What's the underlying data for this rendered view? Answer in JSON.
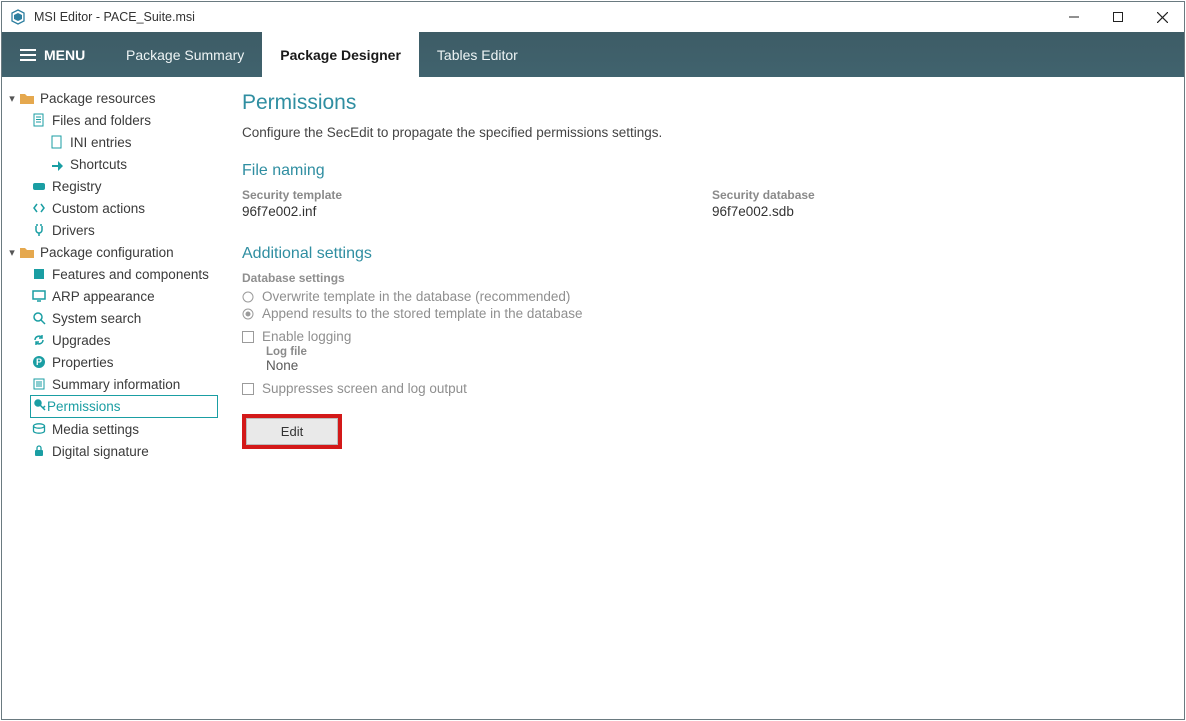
{
  "window": {
    "title": "MSI Editor - PACE_Suite.msi"
  },
  "menu": {
    "label": "MENU"
  },
  "tabs": [
    {
      "label": "Package Summary",
      "active": false
    },
    {
      "label": "Package Designer",
      "active": true
    },
    {
      "label": "Tables Editor",
      "active": false
    }
  ],
  "sidebar": {
    "section1": {
      "label": "Package resources",
      "files_folders": "Files and folders",
      "ini": "INI entries",
      "shortcuts": "Shortcuts",
      "registry": "Registry",
      "custom_actions": "Custom actions",
      "drivers": "Drivers"
    },
    "section2": {
      "label": "Package configuration",
      "features": "Features and components",
      "arp": "ARP appearance",
      "search": "System search",
      "upgrades": "Upgrades",
      "properties": "Properties",
      "summary": "Summary information",
      "permissions": "Permissions",
      "media": "Media settings",
      "signature": "Digital signature"
    }
  },
  "page": {
    "title": "Permissions",
    "desc": "Configure the SecEdit to propagate the specified permissions settings.",
    "file_naming": {
      "heading": "File naming",
      "template_label": "Security template",
      "template_value": "96f7e002.inf",
      "database_label": "Security database",
      "database_value": "96f7e002.sdb"
    },
    "additional": {
      "heading": "Additional settings",
      "db_label": "Database settings",
      "opt_overwrite": "Overwrite template in the database (recommended)",
      "opt_append": "Append results to the stored template in the database",
      "opt_logging": "Enable logging",
      "log_file_label": "Log file",
      "log_file_value": "None",
      "opt_suppress": "Suppresses screen and log output"
    },
    "edit_button": "Edit"
  }
}
